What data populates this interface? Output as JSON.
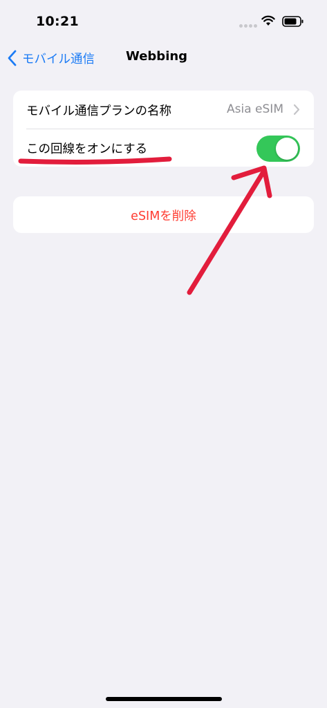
{
  "status_bar": {
    "time": "10:21",
    "icons": [
      "signal-dots-icon",
      "wifi-icon",
      "battery-icon"
    ]
  },
  "nav": {
    "back_label": "モバイル通信",
    "back_icon": "chevron-left-icon",
    "title": "Webbing"
  },
  "settings": {
    "plan_name_label": "モバイル通信プランの名称",
    "plan_name_value": "Asia eSIM",
    "line_on_label": "この回線をオンにする",
    "line_on_state": "on"
  },
  "actions": {
    "delete_esim_label": "eSIMを削除"
  },
  "annotations": {
    "underline_color": "#e21d3c",
    "arrow_color": "#e21d3c"
  },
  "colors": {
    "accent": "#1b7bf5",
    "toggle_on": "#34c759",
    "destructive": "#ff3b30",
    "background": "#f2f1f6"
  }
}
